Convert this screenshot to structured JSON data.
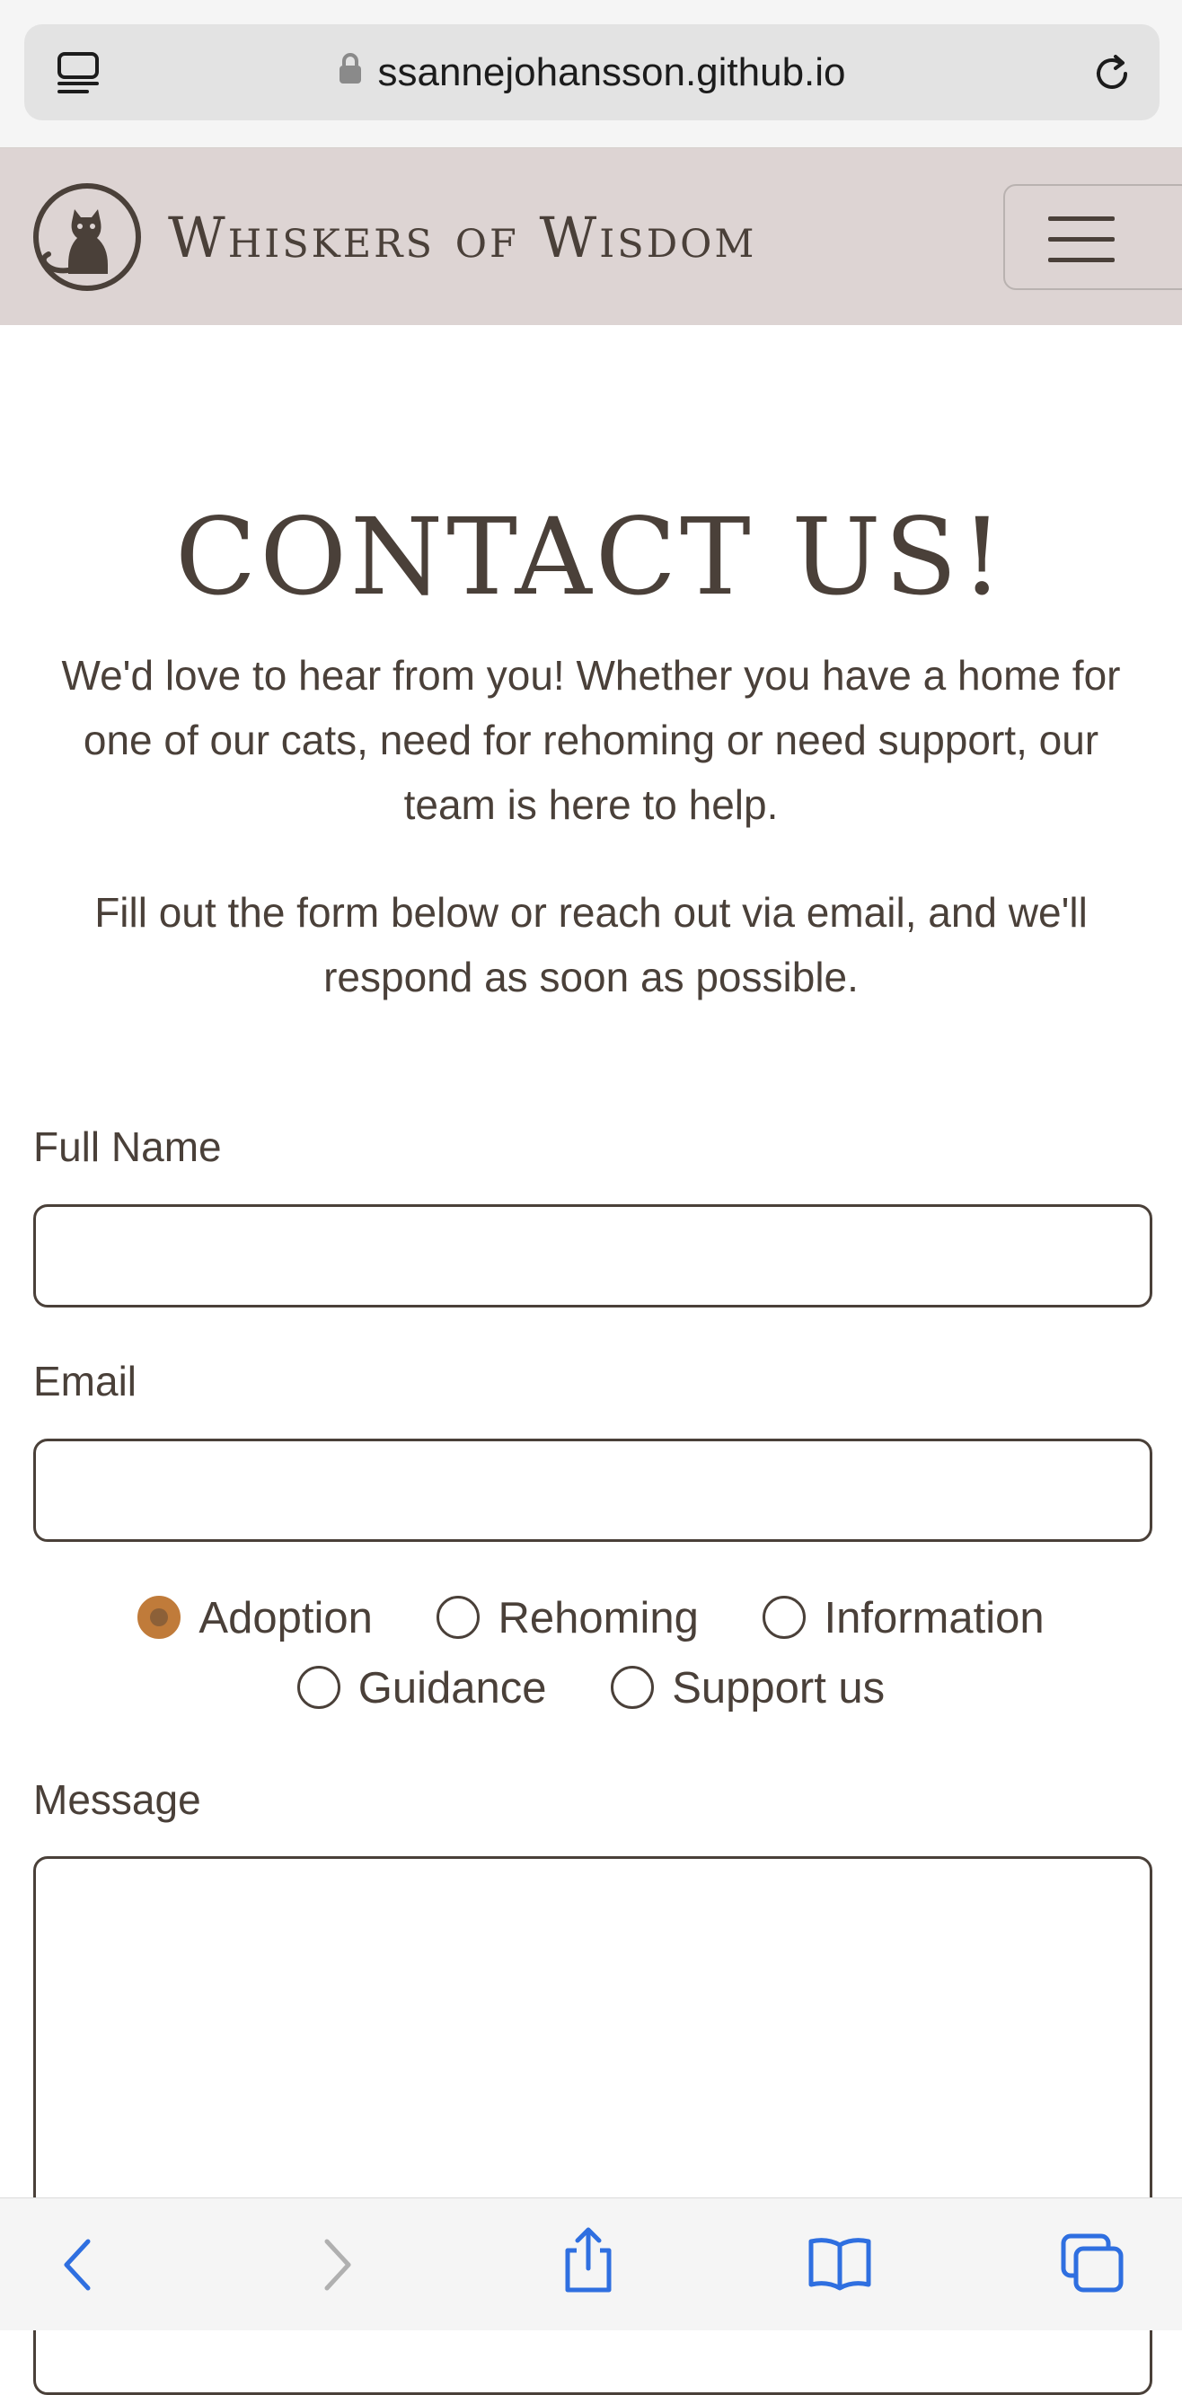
{
  "browser": {
    "url": "ssannejohansson.github.io"
  },
  "header": {
    "brand": "Whiskers of Wisdom"
  },
  "main": {
    "title": "CONTACT US!",
    "intro": "We'd love to hear from you! Whether you have a home for one of our cats, need for rehoming or need support, our team is here to help.",
    "intro2": "Fill out the form below or reach out via email, and we'll respond as soon as possible."
  },
  "form": {
    "full_name_label": "Full Name",
    "full_name_value": "",
    "email_label": "Email",
    "email_value": "",
    "radio_options": [
      "Adoption",
      "Rehoming",
      "Information",
      "Guidance",
      "Support us"
    ],
    "selected_option": "Adoption",
    "message_label": "Message",
    "message_value": ""
  },
  "colors": {
    "header_bg": "#ddd4d3",
    "text": "#4a4039",
    "radio_accent": "#c07b3a",
    "toolbar_blue": "#2f6fe0"
  }
}
